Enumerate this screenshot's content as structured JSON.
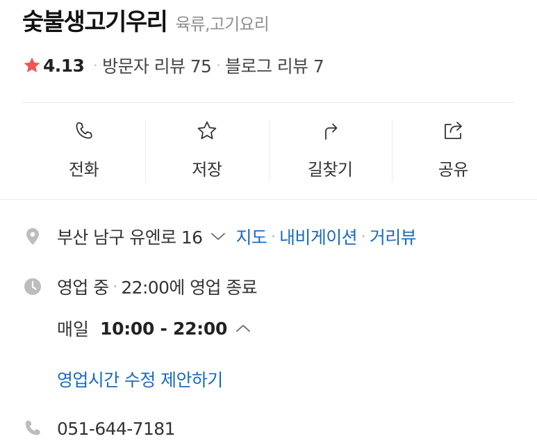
{
  "place": {
    "name": "숯불생고기우리",
    "category": "육류,고기요리"
  },
  "rating": {
    "score": "4.13",
    "visitor_reviews": "방문자 리뷰 75",
    "blog_reviews": "블로그 리뷰 7"
  },
  "actions": [
    {
      "label": "전화",
      "icon": "phone-icon"
    },
    {
      "label": "저장",
      "icon": "star-outline-icon"
    },
    {
      "label": "길찾기",
      "icon": "directions-icon"
    },
    {
      "label": "공유",
      "icon": "share-icon"
    }
  ],
  "address": {
    "text": "부산 남구 유엔로 16",
    "links": [
      "지도",
      "내비게이션",
      "거리뷰"
    ]
  },
  "hours": {
    "status": "영업 중",
    "closing": "22:00에 영업 종료",
    "day": "매일",
    "time": "10:00 - 22:00",
    "suggest_edit": "영업시간 수정 제안하기"
  },
  "phone": "051-644-7181",
  "colors": {
    "star": "#f25555",
    "link": "#1a6ac0",
    "icon_gray": "#bdbdbd",
    "muted": "#8f8f8f"
  }
}
